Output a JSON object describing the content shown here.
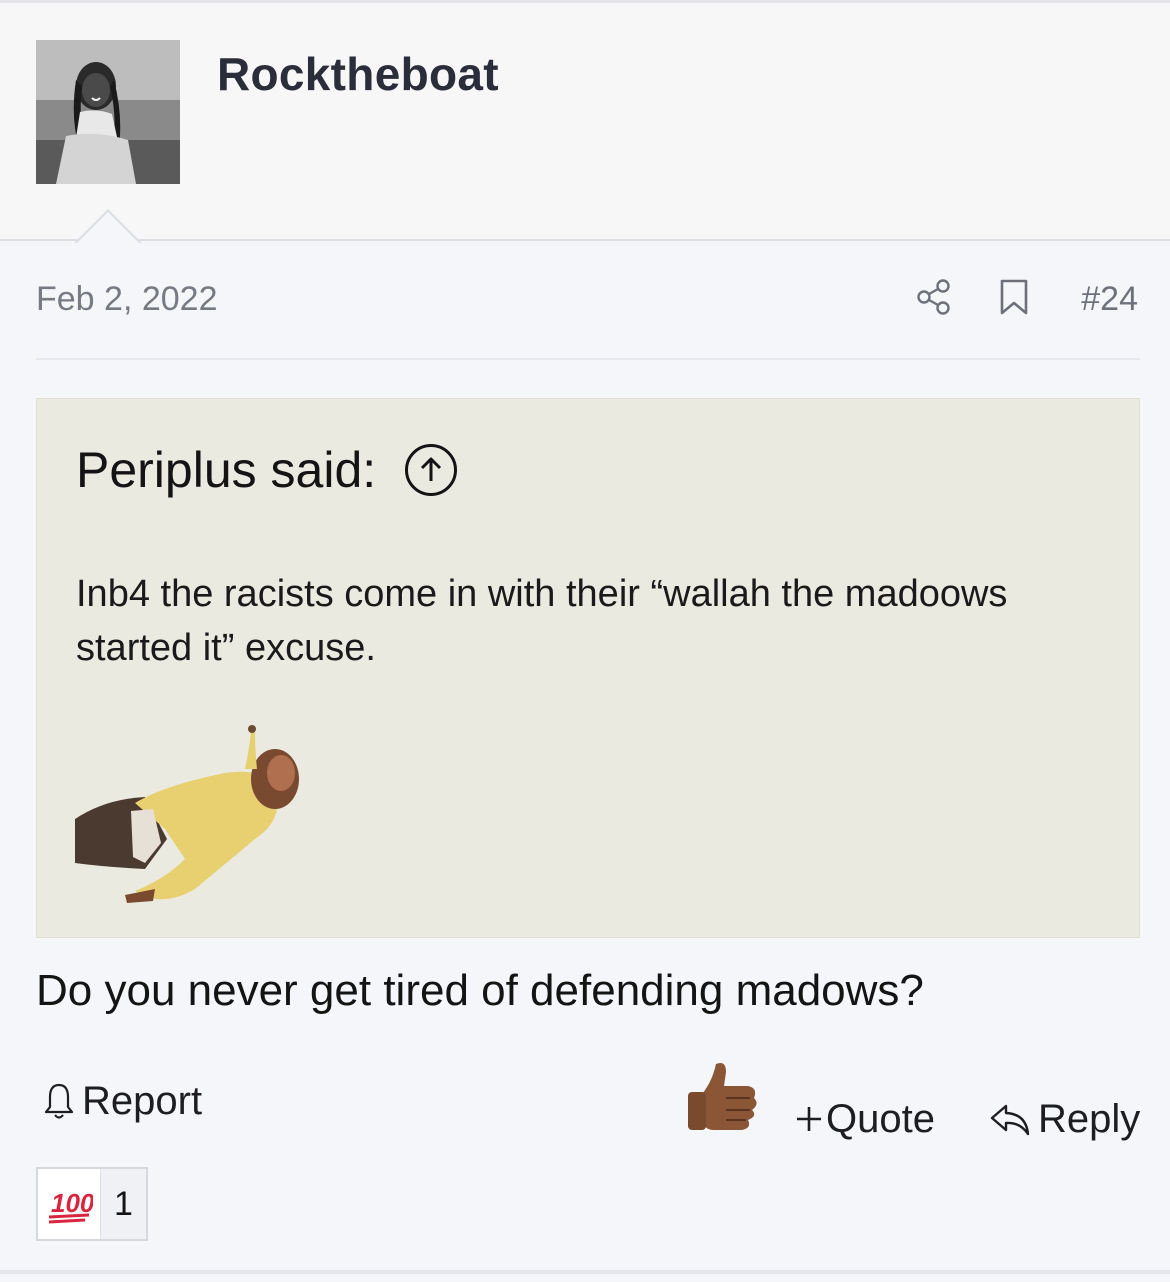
{
  "post": {
    "username": "Rocktheboat",
    "date": "Feb 2, 2022",
    "number": "#24",
    "body": "Do you never get tired of defending madows?"
  },
  "quote": {
    "author": "Periplus said:",
    "text": "Inb4 the racists come in with their “wallah the madoows started it” excuse."
  },
  "actions": {
    "report": "Report",
    "quote": "Quote",
    "reply": "Reply"
  },
  "reactions": [
    {
      "emoji": "100-emoji",
      "count": "1"
    }
  ],
  "icons": {
    "share": "share-icon",
    "bookmark": "bookmark-icon",
    "quote_jump": "arrow-up-circle-icon",
    "report": "bell-icon",
    "quote": "plus-icon",
    "reply": "reply-arrow-icon",
    "thumbs_up": "thumbs-up-emoji"
  },
  "colors": {
    "page_bg": "#f5f6fa",
    "quote_bg": "#ebeae0",
    "username": "#2b2e3a",
    "meta_text": "#777a82",
    "hundred_red": "#d7263d"
  }
}
